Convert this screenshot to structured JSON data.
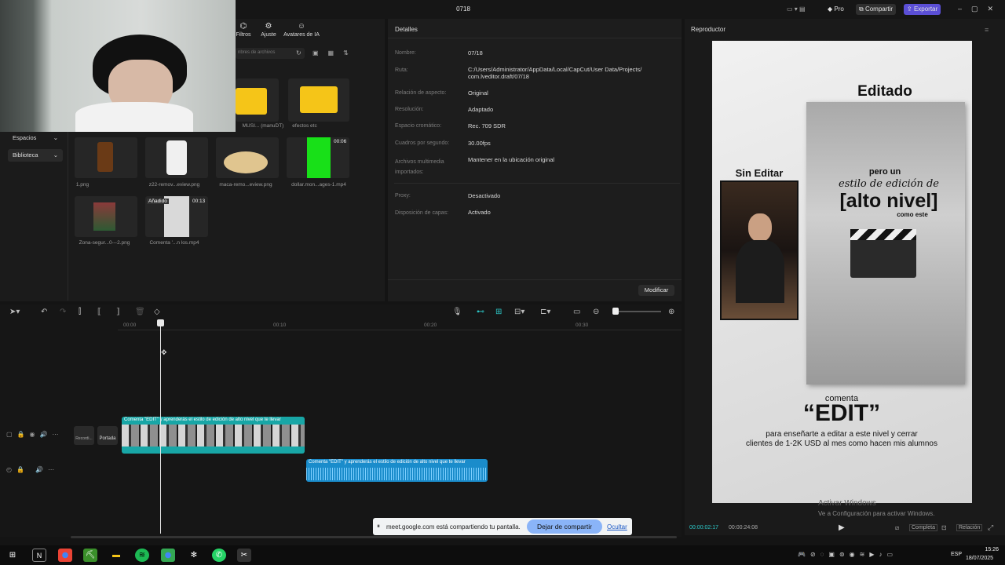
{
  "app": {
    "title": "0718",
    "pro": "Pro",
    "share": "Compartir",
    "export": "Exportar"
  },
  "toolbar": {
    "filters": "Filtros",
    "adjust": "Ajuste",
    "avatars": "Avatares de IA"
  },
  "media": {
    "search_placeholder": "nbres de archivos",
    "sidebar": [
      {
        "label": "Espacios"
      },
      {
        "label": "Biblioteca"
      }
    ],
    "folders": [
      {
        "label": "MUSI... (manuDT)"
      },
      {
        "label": "efectos etc"
      }
    ],
    "items": [
      {
        "label": "1.png",
        "duration": ""
      },
      {
        "label": "z22-remov...eview.png",
        "duration": ""
      },
      {
        "label": "maca-remo...eview.png",
        "duration": ""
      },
      {
        "label": "dollar.mon...ages-1.mp4",
        "duration": "00:06"
      },
      {
        "label": "Zona-segur...0---2.png",
        "duration": ""
      },
      {
        "label": "Comenta '...n los.mp4",
        "duration": "00:13",
        "badge": "Añadido"
      }
    ]
  },
  "details": {
    "title": "Detalles",
    "rows": [
      {
        "label": "Nombre:",
        "value": "07/18"
      },
      {
        "label": "Ruta:",
        "value": "C:/Users/Administrator/AppData/Local/CapCut/User Data/Projects/ com.lveditor.draft/07/18"
      },
      {
        "label": "Relación de aspecto:",
        "value": "Original"
      },
      {
        "label": "Resolución:",
        "value": "Adaptado"
      },
      {
        "label": "Espacio cromático:",
        "value": "Rec. 709 SDR"
      },
      {
        "label": "Cuadros por segundo:",
        "value": "30.00fps"
      },
      {
        "label": "Archivos multimedia importados:",
        "value": "Mantener en la ubicación original"
      },
      {
        "label": "Proxy:",
        "value": "Desactivado"
      },
      {
        "label": "Disposición de capas:",
        "value": "Activado"
      }
    ],
    "modify": "Modificar"
  },
  "player": {
    "title": "Reproductor",
    "current_time": "00:00:02:17",
    "total_time": "00:00:24:08",
    "complete": "Completa",
    "ratio": "Relación",
    "activate_title": "Activar Windows",
    "activate_sub": "Ve a Configuración para activar Windows."
  },
  "preview": {
    "editado": "Editado",
    "sin_editar": "Sin Editar",
    "pero_un": "pero un",
    "estilo": "estilo de edición de",
    "alto_nivel": "[alto nivel]",
    "como_este": "como este",
    "comenta": "comenta",
    "edit": "“EDIT”",
    "line1": "para enseñarte a editar a este nivel y cerrar",
    "line2": "clientes de 1-2K USD al mes como hacen mis alumnos"
  },
  "timeline": {
    "ruler": [
      "00:00",
      "00:10",
      "00:20",
      "00:30"
    ],
    "cover_label": "Portada",
    "record_label": "Recordi...",
    "video_clip_label": "Comenta \"EDIT\" y aprenderás el estilo de edición de alto nivel que te llevar",
    "audio_clip_label": "Comenta \"EDIT\" y aprenderás el estilo de edición de alto nivel que te llevar"
  },
  "sharebar": {
    "message": "meet.google.com está compartiendo tu pantalla.",
    "stop": "Dejar de compartir",
    "hide": "Ocultar"
  },
  "taskbar": {
    "lang": "ESP",
    "time": "15:26",
    "date": "18/07/2025"
  }
}
